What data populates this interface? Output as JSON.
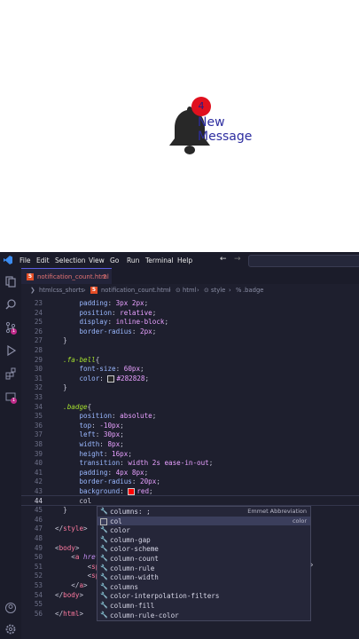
{
  "preview": {
    "badge_text": "4",
    "line1": "New",
    "line2": "Message"
  },
  "titlebar": {
    "menus": [
      "File",
      "Edit",
      "Selection",
      "View",
      "Go",
      "Run",
      "Terminal",
      "Help"
    ],
    "back_icon": "arrow-left-icon",
    "forward_icon": "arrow-right-icon"
  },
  "activity_bar": {
    "icons": [
      "explorer-icon",
      "search-icon",
      "source-control-icon",
      "run-debug-icon",
      "extensions-icon",
      "remote-icon",
      "account-icon",
      "settings-icon"
    ],
    "badges": {
      "source_control": "1",
      "remote": "1"
    }
  },
  "tab": {
    "label": "notification_count.html",
    "count": "2"
  },
  "breadcrumb": [
    "htmlcss_shorts",
    "notification_count.html",
    "html",
    "style",
    ".badge"
  ],
  "code_lines": [
    {
      "n": "23",
      "text": "      padding: 3px 2px;"
    },
    {
      "n": "24",
      "text": "      position: relative;"
    },
    {
      "n": "25",
      "text": "      display: inline-block;"
    },
    {
      "n": "26",
      "text": "      border-radius: 2px;"
    },
    {
      "n": "27",
      "text": "  }"
    },
    {
      "n": "28",
      "text": ""
    },
    {
      "n": "29",
      "text": "  .fa-bell{"
    },
    {
      "n": "30",
      "text": "      font-size: 60px;"
    },
    {
      "n": "31",
      "text": "      color: #282828;"
    },
    {
      "n": "32",
      "text": "  }"
    },
    {
      "n": "33",
      "text": ""
    },
    {
      "n": "34",
      "text": "  .badge{"
    },
    {
      "n": "35",
      "text": "      position: absolute;"
    },
    {
      "n": "36",
      "text": "      top: -10px;"
    },
    {
      "n": "37",
      "text": "      left: 30px;"
    },
    {
      "n": "38",
      "text": "      width: 8px;"
    },
    {
      "n": "39",
      "text": "      height: 16px;"
    },
    {
      "n": "40",
      "text": "      transition: width 2s ease-in-out;"
    },
    {
      "n": "41",
      "text": "      padding: 4px 8px;"
    },
    {
      "n": "42",
      "text": "      border-radius: 20px;"
    },
    {
      "n": "43",
      "text": "      background: red;"
    },
    {
      "n": "44",
      "text": "      col"
    },
    {
      "n": "45",
      "text": "  }"
    },
    {
      "n": "46",
      "text": ""
    },
    {
      "n": "47",
      "text": "</style>"
    },
    {
      "n": "48",
      "text": ""
    },
    {
      "n": "49",
      "text": "<body>"
    },
    {
      "n": "50",
      "text": "    <a href"
    },
    {
      "n": "51",
      "text": "        <sp"
    },
    {
      "n": "52",
      "text": "        <sp"
    },
    {
      "n": "53",
      "text": "    </a>"
    },
    {
      "n": "54",
      "text": "</body>"
    },
    {
      "n": "55",
      "text": ""
    },
    {
      "n": "56",
      "text": "</html>"
    }
  ],
  "suggestions": [
    {
      "label": "columns: ;",
      "kind": "wrench",
      "detail": "Emmet Abbreviation"
    },
    {
      "label": "col",
      "kind": "box",
      "detail": "color"
    },
    {
      "label": "color",
      "kind": "wrench",
      "detail": ""
    },
    {
      "label": "column-gap",
      "kind": "wrench",
      "detail": ""
    },
    {
      "label": "color-scheme",
      "kind": "wrench",
      "detail": ""
    },
    {
      "label": "column-count",
      "kind": "wrench",
      "detail": ""
    },
    {
      "label": "column-rule",
      "kind": "wrench",
      "detail": ""
    },
    {
      "label": "column-width",
      "kind": "wrench",
      "detail": ""
    },
    {
      "label": "columns",
      "kind": "wrench",
      "detail": ""
    },
    {
      "label": "color-interpolation-filters",
      "kind": "wrench",
      "detail": ""
    },
    {
      "label": "column-fill",
      "kind": "wrench",
      "detail": ""
    },
    {
      "label": "column-rule-color",
      "kind": "wrench",
      "detail": ""
    }
  ],
  "colors": {
    "swatch_282828": "#282828",
    "swatch_red": "#ff0000",
    "accent": "#5a5ee0"
  }
}
